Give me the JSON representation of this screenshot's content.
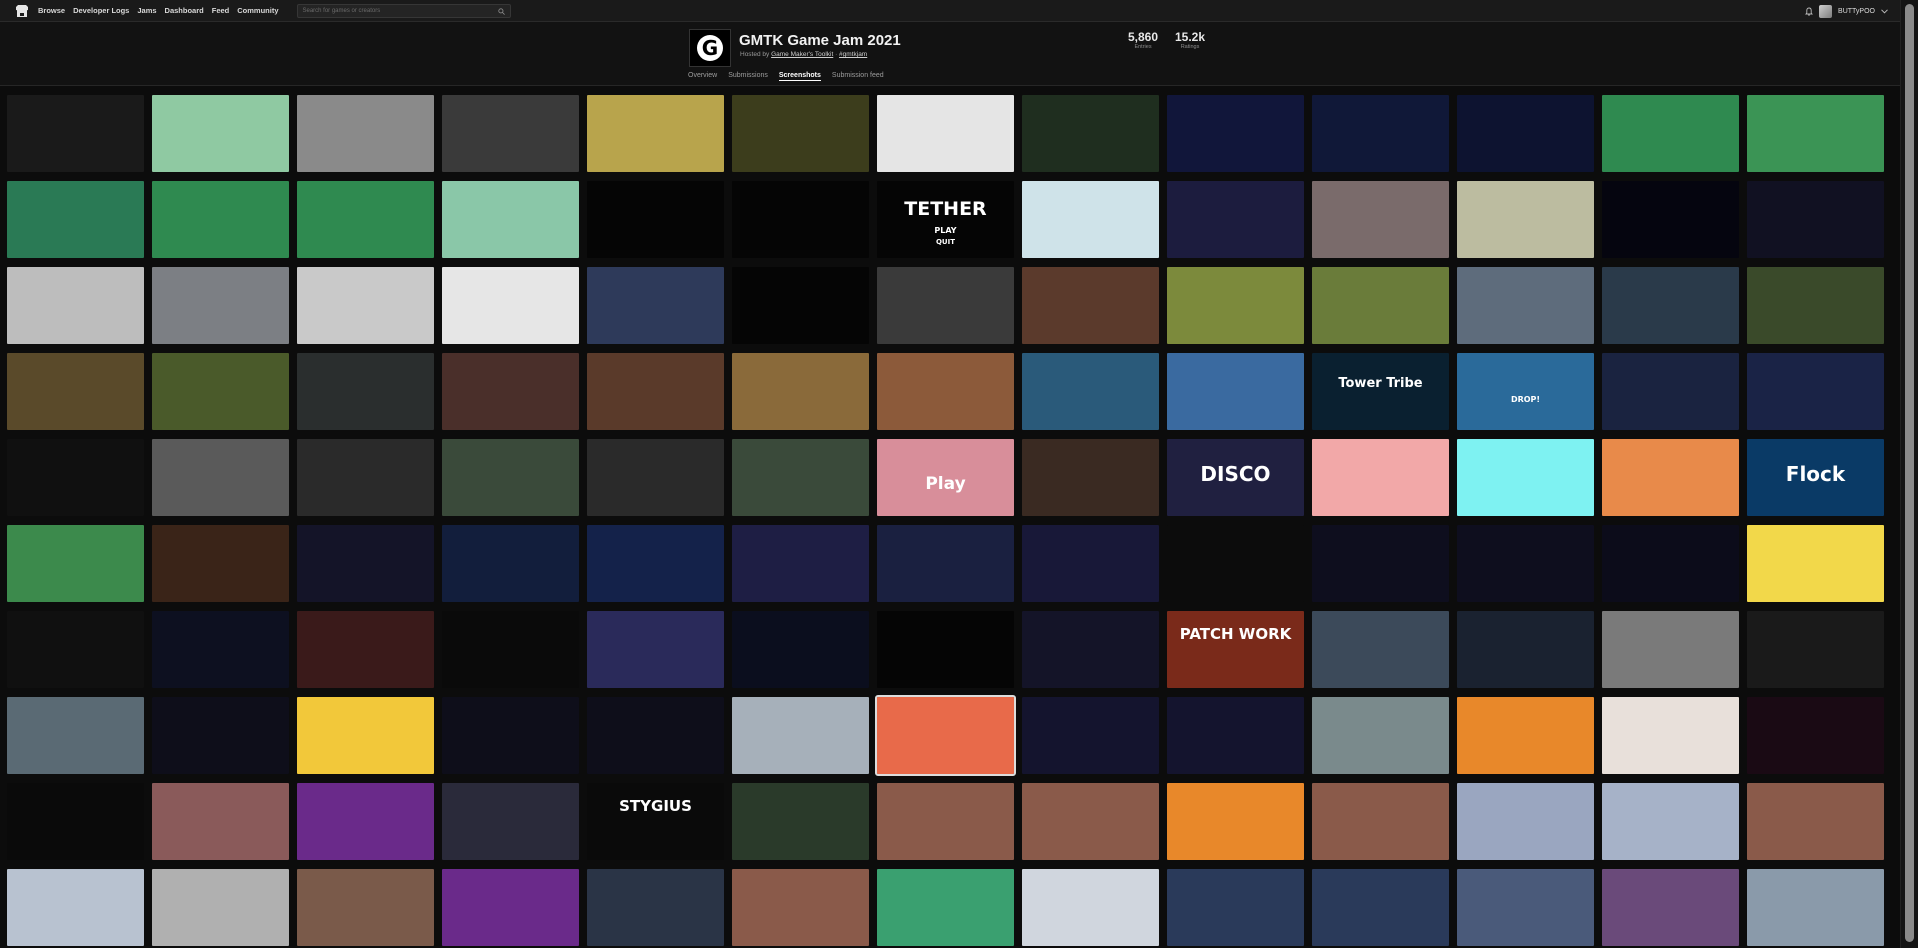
{
  "nav": {
    "links": [
      "Browse",
      "Developer Logs",
      "Jams",
      "Dashboard",
      "Feed",
      "Community"
    ],
    "search_placeholder": "Search for games or creators",
    "username": "BUTTyPOO"
  },
  "jam": {
    "title": "GMTK Game Jam 2021",
    "hosted_prefix": "Hosted by",
    "host": "Game Maker's Toolkit",
    "hashtag": "#gmtkjam",
    "entries_value": "5,860",
    "entries_label": "Entries",
    "ratings_value": "15.2k",
    "ratings_label": "Ratings"
  },
  "tabs": [
    {
      "label": "Overview",
      "active": false
    },
    {
      "label": "Submissions",
      "active": false
    },
    {
      "label": "Screenshots",
      "active": true
    },
    {
      "label": "Submission feed",
      "active": false
    }
  ],
  "colors": {
    "accent": "#ffffff",
    "background": "#0c0c0c"
  },
  "screenshot_labels": [
    "TETHER",
    "PLAY",
    "QUIT",
    "Tower Tribe",
    "DROP!",
    "Play",
    "DISCO",
    "Flock",
    "PATCH WORK",
    "STYGIUS"
  ],
  "tile_colors": [
    "#1a1a1a",
    "#8fc9a2",
    "#8a8a8a",
    "#3a3a3a",
    "#b8a44c",
    "#3c3d1c",
    "#e5e5e5",
    "#1f2e1f",
    "#11163a",
    "#101838",
    "#0d1330",
    "#2f8a50",
    "#3b9455",
    "#2a7a55",
    "#2f8a50",
    "#2f8a50",
    "#8ac7a8",
    "#050505",
    "#050505",
    "#050505",
    "#cfe3e9",
    "#1c1c3e",
    "#7a6b6b",
    "#bcbca0",
    "#05050f",
    "#111122",
    "#bdbdbd",
    "#7c7f84",
    "#c9c9c9",
    "#e6e6e6",
    "#2e3a5a",
    "#050505",
    "#3a3a3a",
    "#5b3a2c",
    "#7c8a3c",
    "#6a7c3a",
    "#5e6c7c",
    "#2a3a4a",
    "#3a4a2a",
    "#5a4a2a",
    "#4a5a2a",
    "#2a2e2e",
    "#4a2f2a",
    "#5a3a2a",
    "#8a6a3a",
    "#8c5a3a",
    "#2a5a7a",
    "#3a6aa0",
    "#0a2030",
    "#2a6a9a",
    "#1a2340",
    "#1a2346",
    "#101010",
    "#5a5a5a",
    "#2a2a2a",
    "#3a4a3a",
    "#2a2a2a",
    "#3a4a3a",
    "#d88e9a",
    "#3a2a22",
    "#202040",
    "#f2a8a8",
    "#7ef2f2",
    "#e88a4a",
    "#0a3a66",
    "#3c8a4c",
    "#3a2418",
    "#141428",
    "#121e3c",
    "#14224a",
    "#1e1e44",
    "#1a2040",
    "#181838",
    "#0c0c0c",
    "#0e0e1e",
    "#0e0e1e",
    "#0c0c1a",
    "#f2d84a",
    "#101010",
    "#0d1020",
    "#3a1a1a",
    "#0a0a0a",
    "#2a2a5a",
    "#0b0e1e",
    "#050505",
    "#141428",
    "#7a2a1a",
    "#3c4a5a",
    "#1a2230",
    "#7a7a7a",
    "#1a1a1a",
    "#5a6a74",
    "#0e0e1a",
    "#f2c83a",
    "#0e0e1a",
    "#0e0e1a",
    "#a6b0ba",
    "#e86a4a",
    "#14142e",
    "#14142e",
    "#7a8a8c",
    "#e8882a",
    "#e8e0da",
    "#1a0a14",
    "#0a0a0a",
    "#8a5a5a",
    "#6a2a8a",
    "#2a2a3a",
    "#0a0a0a",
    "#2a3a2a",
    "#8a5a4a",
    "#8a5a4a",
    "#e8882a",
    "#8a5a4a",
    "#9aa6c0",
    "#a6b2c8",
    "#8a5a4a",
    "#b8c2d0",
    "#b0b0b0",
    "#7a5a4a",
    "#6a2a8a",
    "#2a3446",
    "#8a5a4a",
    "#3aa070",
    "#d0d6de",
    "#2a3a5a",
    "#2a3a5a",
    "#4a5a7a",
    "#6a4a7a",
    "#8a9aaa"
  ]
}
